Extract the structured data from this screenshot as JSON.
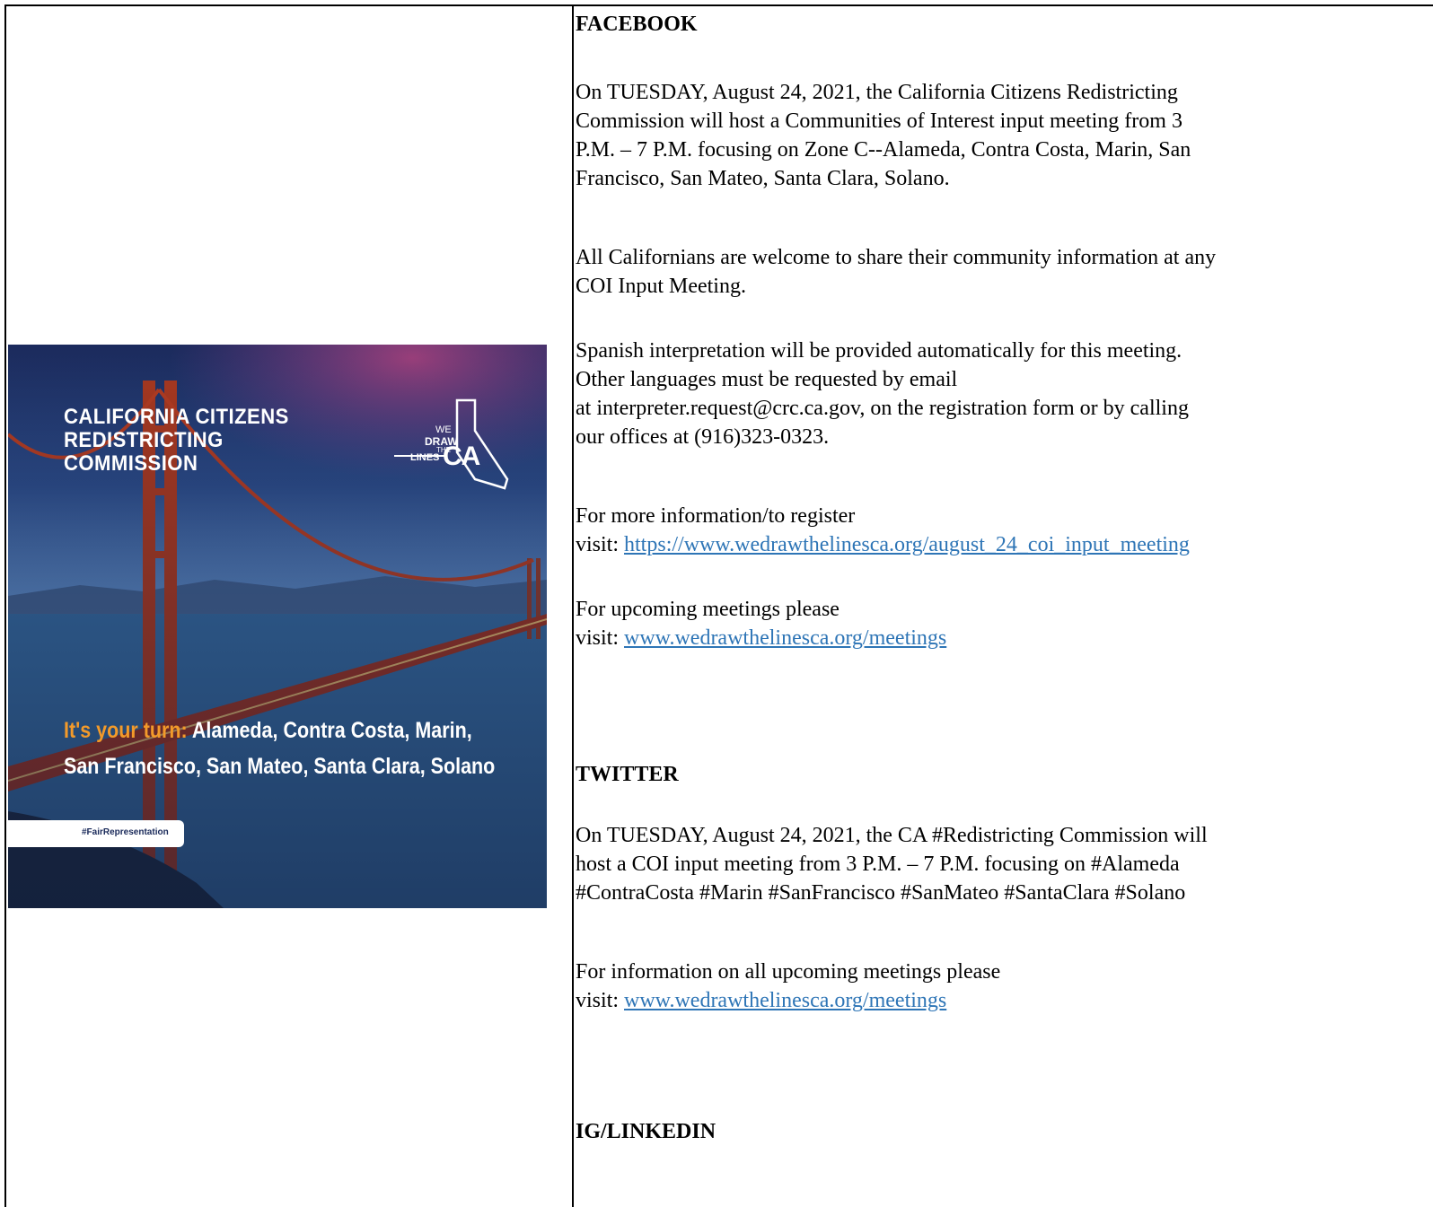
{
  "graphic": {
    "title_lines": [
      "CALIFORNIA CITIZENS",
      "REDISTRICTING",
      "COMMISSION"
    ],
    "logo": {
      "we": "WE",
      "draw": "DRAW",
      "the": "THE",
      "lines": "LINES",
      "ca": "CA"
    },
    "tagline_accent": "It's your turn:",
    "tagline_line1_rest": "Alameda, Contra Costa, Marin,",
    "tagline_line2": "San Francisco, San Mateo, Santa Clara, Solano",
    "hashtag": "#FairRepresentation",
    "colors": {
      "sky_top": "#1b2a5c",
      "sky_mid": "#3c6aa8",
      "aurora": "#7a3d8c",
      "water": "#3e78ad",
      "bridge": "#b23b20",
      "accent": "#f39a2a"
    }
  },
  "facebook": {
    "heading": "FACEBOOK",
    "p1": [
      "On TUESDAY, August 24, 2021, the California Citizens Redistricting",
      "Commission will host a Communities of Interest input meeting from 3",
      "P.M. – 7 P.M. focusing on Zone C--Alameda, Contra Costa, Marin, San",
      "Francisco, San Mateo, Santa Clara, Solano."
    ],
    "p2": [
      "All Californians are welcome to share their community information at any",
      "COI Input Meeting."
    ],
    "p3": [
      "Spanish interpretation will be provided automatically for this meeting.",
      "Other languages must be requested by email",
      "at interpreter.request@crc.ca.gov, on the registration form or by calling",
      "our offices at (916)323-0323."
    ],
    "register_intro": "For more information/to register",
    "visit_label": "visit: ",
    "register_link": "https://www.wedrawthelinesca.org/august_24_coi_input_meeting",
    "upcoming_intro": "For upcoming meetings please",
    "meetings_link": "www.wedrawthelinesca.org/meetings"
  },
  "twitter": {
    "heading": "TWITTER",
    "p1": [
      "On TUESDAY, August 24, 2021, the CA #Redistricting Commission will",
      "host a COI input meeting from 3 P.M. – 7 P.M. focusing on #Alameda",
      "#ContraCosta #Marin #SanFrancisco #SanMateo #SantaClara #Solano"
    ],
    "info_intro": "For information on all upcoming meetings please",
    "visit_label": "visit: ",
    "meetings_link": "www.wedrawthelinesca.org/meetings"
  },
  "ig_linkedin": {
    "heading": "IG/LINKEDIN"
  }
}
